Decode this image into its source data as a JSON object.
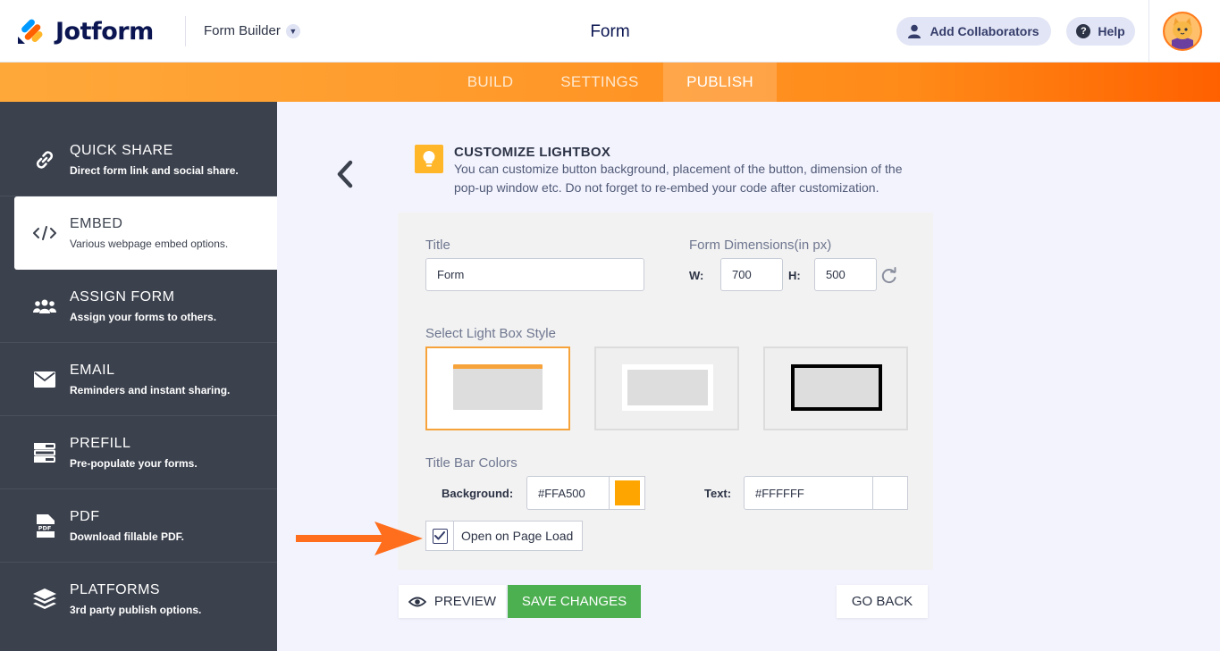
{
  "header": {
    "brand": "Jotform",
    "builder_label": "Form Builder",
    "title": "Form",
    "add_collaborators": "Add Collaborators",
    "help": "Help"
  },
  "tabs": [
    {
      "label": "BUILD"
    },
    {
      "label": "SETTINGS"
    },
    {
      "label": "PUBLISH"
    }
  ],
  "sidebar": {
    "items": [
      {
        "title": "QUICK SHARE",
        "subtitle": "Direct form link and social share.",
        "icon": "link-icon"
      },
      {
        "title": "EMBED",
        "subtitle": "Various webpage embed options.",
        "icon": "code-icon"
      },
      {
        "title": "ASSIGN FORM",
        "subtitle": "Assign your forms to others.",
        "icon": "people-icon"
      },
      {
        "title": "EMAIL",
        "subtitle": "Reminders and instant sharing.",
        "icon": "envelope-icon"
      },
      {
        "title": "PREFILL",
        "subtitle": "Pre-populate your forms.",
        "icon": "prefill-icon"
      },
      {
        "title": "PDF",
        "subtitle": "Download fillable PDF.",
        "icon": "pdf-icon"
      },
      {
        "title": "PLATFORMS",
        "subtitle": "3rd party publish options.",
        "icon": "layers-icon"
      }
    ],
    "active_index": 1
  },
  "main": {
    "info_title": "CUSTOMIZE LIGHTBOX",
    "info_desc": "You can customize button background, placement of the button, dimension of the pop-up window etc. Do not forget to re-embed your code after customization.",
    "title_label": "Title",
    "title_value": "Form",
    "dimensions_label": "Form Dimensions(in px)",
    "width_label": "W:",
    "width_value": "700",
    "height_label": "H:",
    "height_value": "500",
    "style_label": "Select Light Box Style",
    "selected_style_index": 0,
    "colors_label": "Title Bar Colors",
    "bg_label": "Background:",
    "bg_value": "#FFA500",
    "text_label": "Text:",
    "text_value": "#FFFFFF",
    "open_on_load_label": "Open on Page Load",
    "open_on_load_checked": true
  },
  "buttons": {
    "preview": "PREVIEW",
    "save": "SAVE CHANGES",
    "go_back": "GO BACK"
  },
  "colors": {
    "accent": "#ff6100",
    "save_green": "#4caf50",
    "sidebar_bg": "#3b414d",
    "swatch_bg": "#FFA500",
    "swatch_text": "#FFFFFF"
  }
}
